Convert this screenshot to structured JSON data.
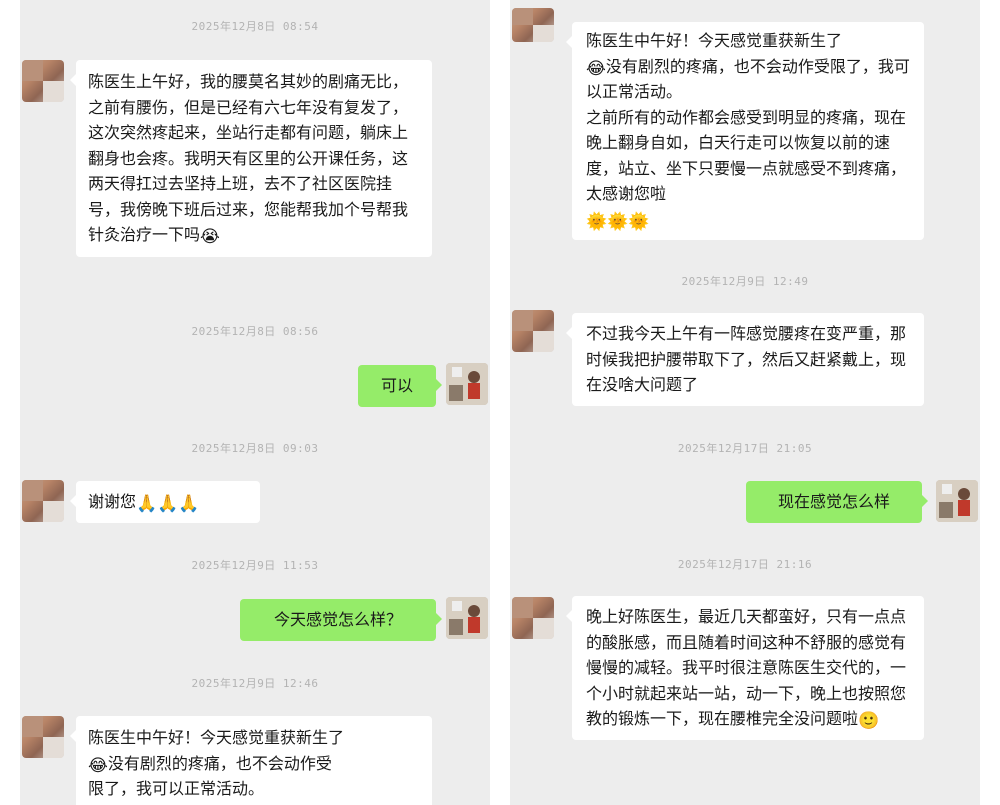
{
  "left": {
    "timestamps": [
      "2025年12月8日 08:54",
      "2025年12月8日 08:56",
      "2025年12月8日 09:03",
      "2025年12月9日 11:53",
      "2025年12月9日 12:46"
    ],
    "msg1": {
      "text": "陈医生上午好，我的腰莫名其妙的剧痛无比，之前有腰伤，但是已经有六七年没有复发了，这次突然疼起来，坐站行走都有问题，躺床上翻身也会疼。我明天有区里的公开课任务，这两天得扛过去坚持上班，去不了社区医院挂号，我傍晚下班后过来，您能帮我加个号帮我针灸治疗一下吗",
      "emoji": "😭",
      "emoji_name": "crying-face"
    },
    "msg2": {
      "text": "可以"
    },
    "msg3": {
      "text": "谢谢您",
      "emoji": "🙏🙏🙏",
      "emoji_name": "folded-hands"
    },
    "msg4": {
      "text": "今天感觉怎么样？"
    },
    "msg5": {
      "line1": "陈医生中午好！今天感觉重获新生了",
      "emoji": "😂",
      "emoji_name": "tears-of-joy",
      "line2": "没有剧烈的疼痛，也不会动作受",
      "line3": "限了，我可以正常活动。"
    }
  },
  "right": {
    "timestamps": [
      "2025年12月9日 12:49",
      "2025年12月17日 21:05",
      "2025年12月17日 21:16"
    ],
    "msg5": {
      "line1": "陈医生中午好！今天感觉重获新生了",
      "emoji": "😂",
      "emoji_name": "tears-of-joy",
      "line2": "没有剧烈的疼痛，也不会动作受限了，我可以正常活动。",
      "para2": "之前所有的动作都会感受到明显的疼痛，现在晚上翻身自如，白天行走可以恢复以前的速度，站立、坐下只要慢一点就感受不到疼痛，太感谢您啦",
      "emoji2": "🌞🌞🌞",
      "emoji2_name": "sun-with-face"
    },
    "msg6": {
      "text": "不过我今天上午有一阵感觉腰疼在变严重，那时候我把护腰带取下了，然后又赶紧戴上，现在没啥大问题了"
    },
    "msg7": {
      "text": "现在感觉怎么样"
    },
    "msg8": {
      "text": "晚上好陈医生，最近几天都蛮好，只有一点点的酸胀感，而且随着时间这种不舒服的感觉有慢慢的减轻。我平时很注意陈医生交代的，一个小时就起来站一站，动一下，晚上也按照您教的锻炼一下，现在腰椎完全没问题啦",
      "emoji": "🙂",
      "emoji_name": "smiling-face"
    }
  },
  "colors": {
    "panel_bg": "#ededed",
    "incoming_bubble": "#ffffff",
    "outgoing_bubble": "#95ec69",
    "timestamp_text": "#b3b3b3"
  }
}
